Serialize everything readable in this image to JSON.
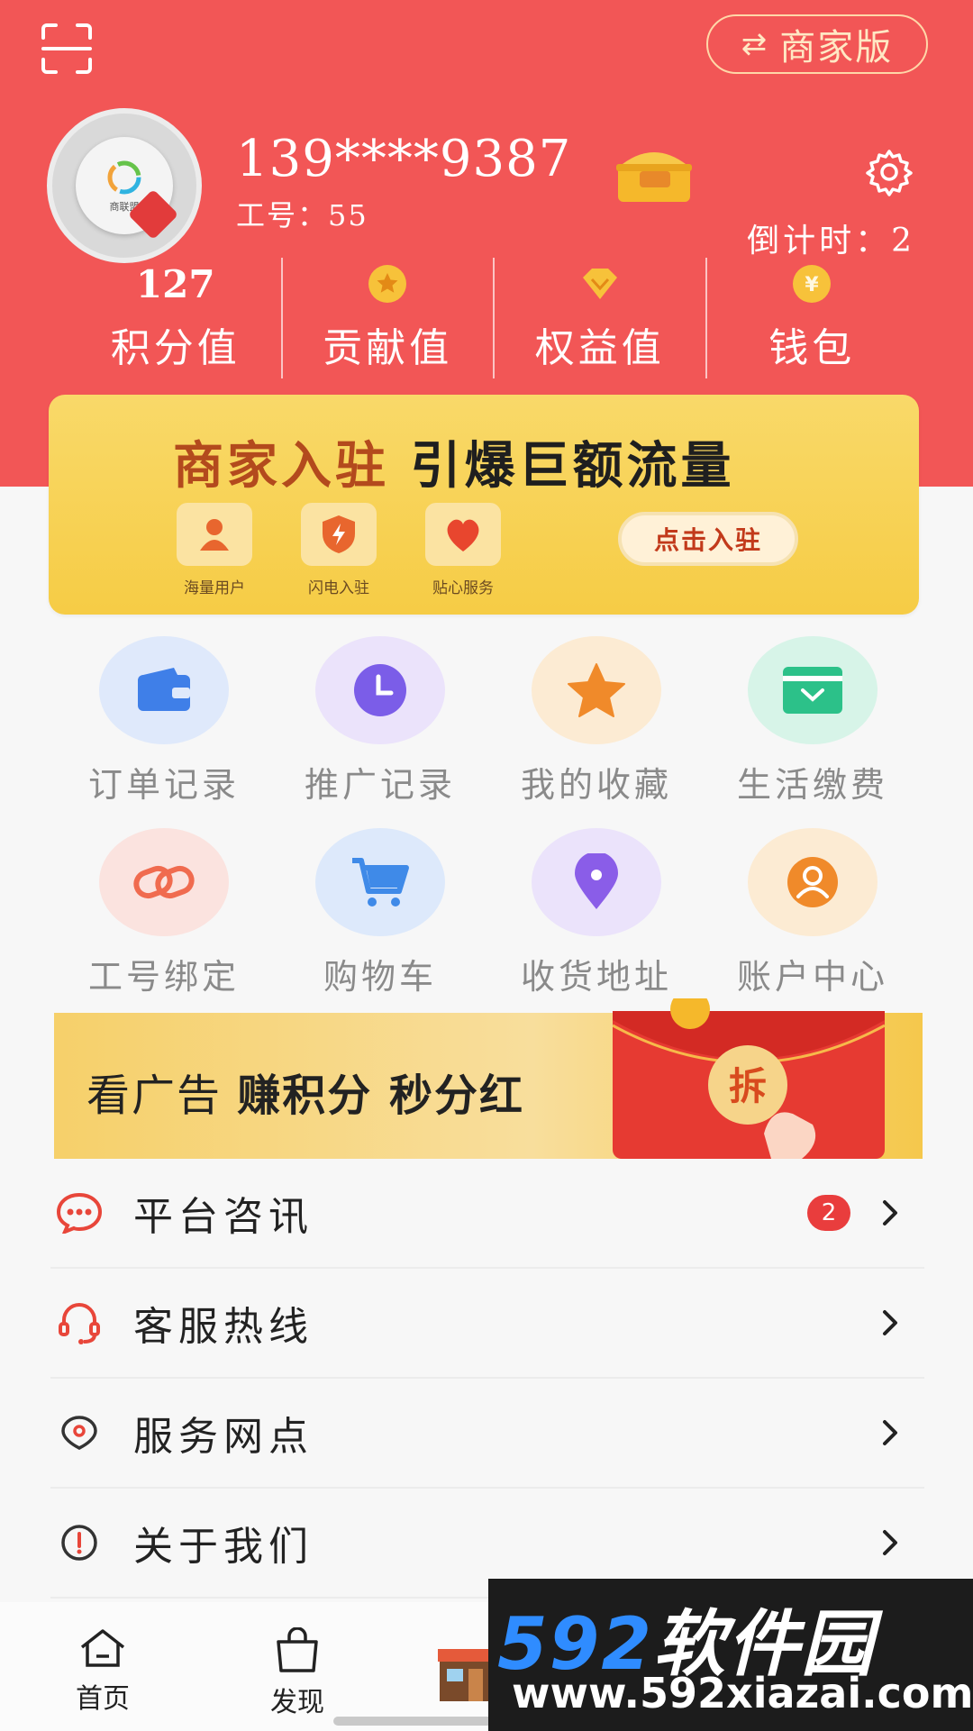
{
  "header": {
    "mode_switch_label": "商家版",
    "phone": "139****9387",
    "job_number": "工号：55",
    "countdown": "倒计时：2",
    "avatar_logo_text": "商联盟",
    "bg_color": "#f25656"
  },
  "stats": [
    {
      "top": "127",
      "label": "积分值"
    },
    {
      "icon": "medal-icon",
      "label": "贡献值"
    },
    {
      "icon": "diamond-icon",
      "label": "权益值"
    },
    {
      "icon": "yen-coin-icon",
      "label": "钱包"
    }
  ],
  "merchant_banner": {
    "headline_accent": "商家入驻",
    "headline_rest": " 引爆巨额流量",
    "features": [
      "海量用户",
      "闪电入驻",
      "贴心服务"
    ],
    "button": "点击入驻"
  },
  "grid": [
    {
      "label": "订单记录",
      "icon": "wallet-icon",
      "bg": "#dfe9fb",
      "color": "#3f7fe8"
    },
    {
      "label": "推广记录",
      "icon": "clock-icon",
      "bg": "#ebe3fb",
      "color": "#7b5de8"
    },
    {
      "label": "我的收藏",
      "icon": "star-icon",
      "bg": "#fcebd3",
      "color": "#f08a2a"
    },
    {
      "label": "生活缴费",
      "icon": "bill-icon",
      "bg": "#d7f4e8",
      "color": "#2cc189"
    },
    {
      "label": "工号绑定",
      "icon": "link-icon",
      "bg": "#fbe3df",
      "color": "#f06b4f"
    },
    {
      "label": "购物车",
      "icon": "cart-icon",
      "bg": "#dde9fb",
      "color": "#3f8ae8"
    },
    {
      "label": "收货地址",
      "icon": "location-pin-icon",
      "bg": "#ebe3fb",
      "color": "#8a5de8"
    },
    {
      "label": "账户中心",
      "icon": "user-icon",
      "bg": "#fcebd3",
      "color": "#f08a2a"
    }
  ],
  "ad_banner": {
    "text_plain": "看广告 ",
    "text_bold": "赚积分 秒分红",
    "packet_char": "拆"
  },
  "menu": [
    {
      "title": "平台咨讯",
      "icon": "chat-bubble-icon",
      "badge": "2"
    },
    {
      "title": "客服热线",
      "icon": "headset-icon"
    },
    {
      "title": "服务网点",
      "icon": "location-icon"
    },
    {
      "title": "关于我们",
      "icon": "info-icon"
    }
  ],
  "tabbar": [
    {
      "label": "首页",
      "icon": "home-icon"
    },
    {
      "label": "发现",
      "icon": "shopping-bag-icon"
    },
    {
      "label": "",
      "icon": "shop-icon"
    }
  ],
  "watermark": {
    "number": "592",
    "name": "软件园",
    "url": "www.592xiazai.com"
  }
}
